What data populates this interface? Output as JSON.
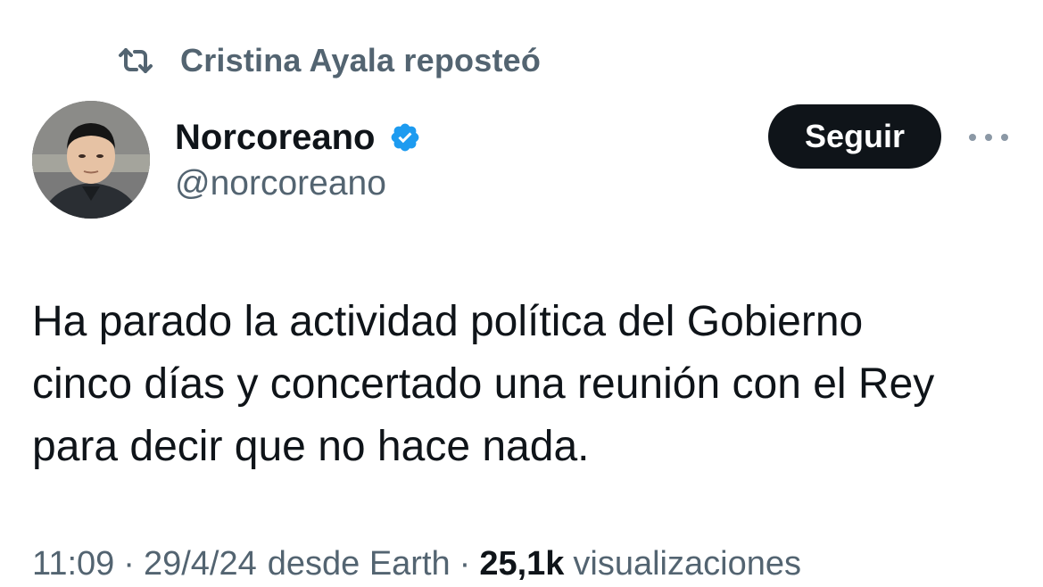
{
  "repost": {
    "icon": "repost-icon",
    "text": "Cristina Ayala reposteó"
  },
  "author": {
    "avatar": "avatar",
    "display_name": "Norcoreano",
    "verified_icon": "verified-badge-icon",
    "handle": "@norcoreano"
  },
  "actions": {
    "follow_label": "Seguir",
    "more_icon": "more-options-icon"
  },
  "tweet": {
    "lines": [
      "Ha parado la actividad política del Gobierno",
      "cinco días y concertado una reunión con el Rey",
      "para decir que no hace nada."
    ]
  },
  "meta": {
    "time": "11:09",
    "separator": "·",
    "date": "29/4/24",
    "source": "desde Earth",
    "views_count": "25,1k",
    "views_label": "visualizaciones"
  },
  "colors": {
    "text_primary": "#0f1419",
    "text_secondary": "#536471",
    "verified_blue": "#1d9bf0",
    "button_bg": "#0f1419",
    "background": "#ffffff"
  }
}
